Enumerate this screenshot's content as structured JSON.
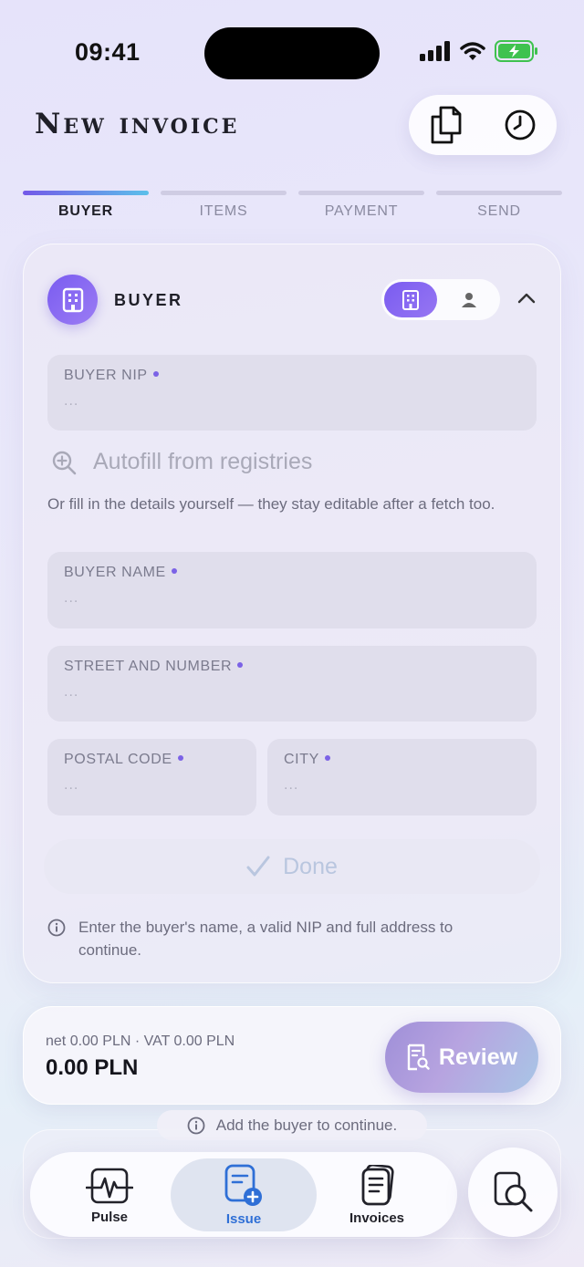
{
  "status_bar": {
    "time": "09:41"
  },
  "header": {
    "title": "New invoice"
  },
  "stepper": {
    "steps": [
      {
        "label": "BUYER",
        "active": true
      },
      {
        "label": "ITEMS",
        "active": false
      },
      {
        "label": "PAYMENT",
        "active": false
      },
      {
        "label": "SEND",
        "active": false
      }
    ]
  },
  "buyer_card": {
    "title": "BUYER",
    "fields": {
      "nip": {
        "label": "BUYER NIP",
        "placeholder": "..."
      },
      "name": {
        "label": "BUYER NAME",
        "placeholder": "..."
      },
      "street": {
        "label": "STREET AND NUMBER",
        "placeholder": "..."
      },
      "postal": {
        "label": "POSTAL CODE",
        "placeholder": "..."
      },
      "city": {
        "label": "CITY",
        "placeholder": "..."
      }
    },
    "autofill_label": "Autofill from registries",
    "helper_text": "Or fill in the details yourself — they stay editable after a fetch too.",
    "done_label": "Done",
    "info_text": "Enter the buyer's name, a valid NIP and full address to continue."
  },
  "totals": {
    "breakdown": "net 0.00 PLN · VAT 0.00 PLN",
    "total": "0.00 PLN",
    "review_label": "Review"
  },
  "hint": {
    "text": "Add the buyer to continue."
  },
  "tabbar": {
    "tabs": [
      {
        "label": "Pulse"
      },
      {
        "label": "Issue"
      },
      {
        "label": "Invoices"
      }
    ]
  },
  "colors": {
    "accent": "#7358e8",
    "active_tab": "#2f6fd6",
    "battery": "#3fc24f"
  },
  "icons": [
    "copy-icon",
    "clock-icon",
    "building-icon",
    "person-icon",
    "chevron-up-icon",
    "search-plus-icon",
    "check-icon",
    "info-icon",
    "receipt-search-icon",
    "pulse-icon",
    "document-plus-icon",
    "documents-icon",
    "search-document-icon"
  ]
}
